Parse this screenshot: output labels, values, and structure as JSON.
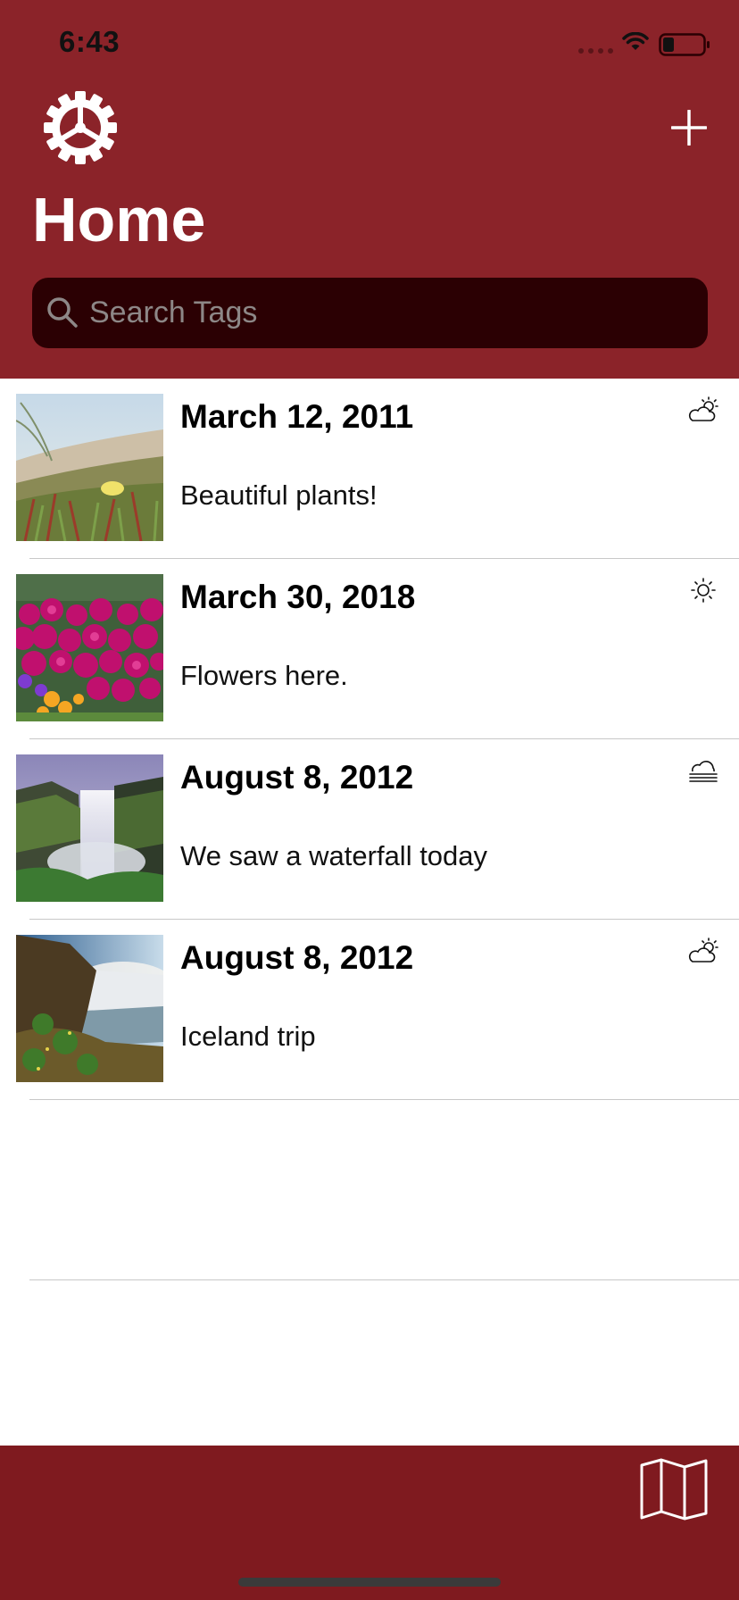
{
  "status_bar": {
    "time": "6:43"
  },
  "nav": {
    "title": "Home"
  },
  "search": {
    "placeholder": "Search Tags",
    "value": ""
  },
  "entries": [
    {
      "date": "March 12, 2011",
      "note": "Beautiful plants!",
      "weather_icon": "partly-cloudy-icon",
      "thumbnail": "dune-plants"
    },
    {
      "date": "March 30, 2018",
      "note": "Flowers here.",
      "weather_icon": "sun-icon",
      "thumbnail": "pink-flowers"
    },
    {
      "date": "August 8, 2012",
      "note": "We saw a waterfall today",
      "weather_icon": "fog-icon",
      "thumbnail": "waterfall"
    },
    {
      "date": "August 8, 2012",
      "note": "Iceland trip",
      "weather_icon": "partly-cloudy-icon",
      "thumbnail": "iceland-waterfall"
    }
  ],
  "colors": {
    "header": "#8b2329",
    "search_bg": "#2b0003",
    "tabbar": "#7f1a1f"
  },
  "icons": {
    "settings": "gear-icon",
    "add": "plus-icon",
    "search": "search-icon",
    "map": "map-icon"
  }
}
